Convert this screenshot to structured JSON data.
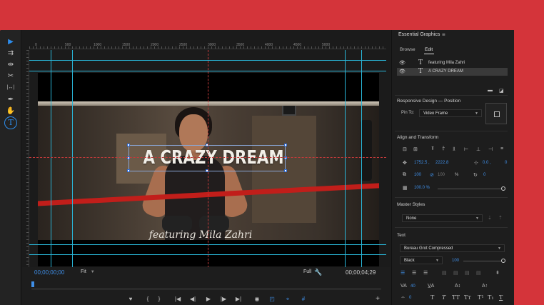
{
  "app": {
    "window_bg": "#1d1d1d",
    "accent": "#2d8ceb",
    "backdrop": "#d4343a"
  },
  "tools": [
    {
      "name": "selection-tool-icon",
      "glyph": "▶"
    },
    {
      "name": "track-select-tool-icon",
      "glyph": "⇉"
    },
    {
      "name": "ripple-edit-tool-icon",
      "glyph": "⇹"
    },
    {
      "name": "razor-tool-icon",
      "glyph": "✂"
    },
    {
      "name": "slip-tool-icon",
      "glyph": "|↔|"
    },
    {
      "name": "pen-tool-icon",
      "glyph": "✒"
    },
    {
      "name": "hand-tool-icon",
      "glyph": "✋"
    },
    {
      "name": "type-tool-icon",
      "glyph": "T"
    }
  ],
  "monitor": {
    "ruler_labels": [
      "0",
      "500",
      "1000",
      "1500",
      "2000",
      "2500",
      "3000",
      "3500",
      "4000",
      "4500",
      "5000"
    ],
    "title_text": "A CRAZY DREAM",
    "subtitle_text": "featuring Mila Zahri",
    "timecode_in": "00;00;00;00",
    "fit_label": "Fit",
    "quality_label": "Full",
    "timecode_out": "00;00;04;29",
    "controls": {
      "marker": "♥",
      "mark_in": "{",
      "mark_out": "}",
      "go_in": "|◀",
      "step_back": "◀|",
      "play": "▶",
      "step_fwd": "|▶",
      "go_out": "▶|",
      "export_frame": "◉",
      "safe_margins": "◰",
      "comparison": "⌖",
      "grid": "#",
      "add": "+"
    }
  },
  "panel": {
    "title": "Essential Graphics",
    "menu": "≡",
    "tabs": {
      "browse": "Browse",
      "edit": "Edit"
    },
    "layers": [
      {
        "name": "featuring Mila Zahri",
        "selected": false
      },
      {
        "name": "A CRAZY DREAM",
        "selected": true
      }
    ],
    "responsive_header": "Responsive Design — Position",
    "pin_to_label": "Pin To:",
    "pin_to_value": "Video Frame",
    "align_header": "Align and Transform",
    "position_x": "1752.5 ,",
    "position_y": "2222.8",
    "anchor_x": "0.0 ,",
    "anchor_y": "0",
    "scale_w": "100",
    "scale_h": "100",
    "scale_unit": "%",
    "rotation": "0",
    "opacity": "100.0 %",
    "master_styles_header": "Master Styles",
    "master_style_value": "None",
    "text_header": "Text",
    "font_family": "Bureau Grot Compressed",
    "font_style": "Black",
    "font_size": "100",
    "tracking": "40",
    "kerning": "0",
    "leading": "0",
    "baseline": "0"
  }
}
